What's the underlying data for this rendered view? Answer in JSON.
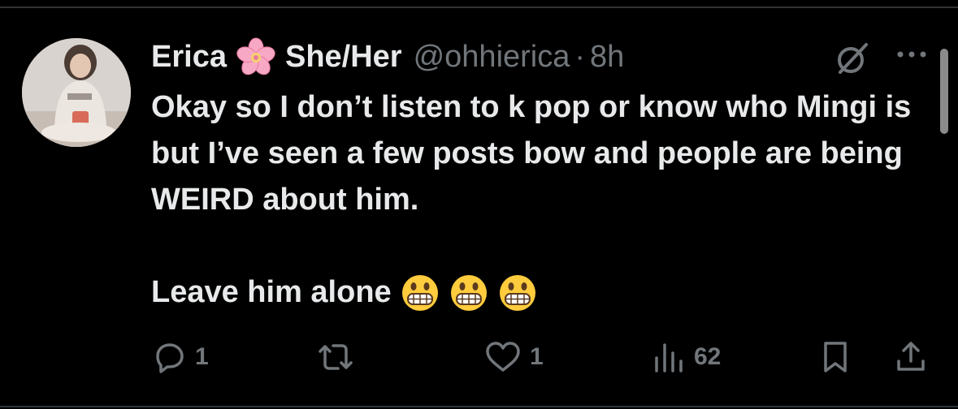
{
  "tweet": {
    "display_name": "Erica",
    "name_emoji": "cherry-blossom-emoji",
    "pronouns": "She/Her",
    "handle": "@ohhierica",
    "separator": "·",
    "time": "8h",
    "text_line1": "Okay so I don’t listen to k pop or know who Mingi is but I’ve seen a few posts bow and people are being WEIRD about him.",
    "text_line2": "Leave him alone",
    "text_line2_emojis": [
      "grimacing-face-emoji",
      "grimacing-face-emoji",
      "grimacing-face-emoji"
    ]
  },
  "actions": {
    "reply_count": "1",
    "repost_count": "",
    "like_count": "1",
    "views_count": "62"
  },
  "icons": {
    "reply": "reply-icon",
    "repost": "repost-icon",
    "like": "heart-icon",
    "views": "views-icon",
    "bookmark": "bookmark-icon",
    "share": "share-icon",
    "grok": "grok-icon",
    "more": "more-icon"
  },
  "colors": {
    "background": "#000000",
    "text_primary": "#e7e9ea",
    "text_secondary": "#71767b",
    "divider": "#2f3336"
  }
}
